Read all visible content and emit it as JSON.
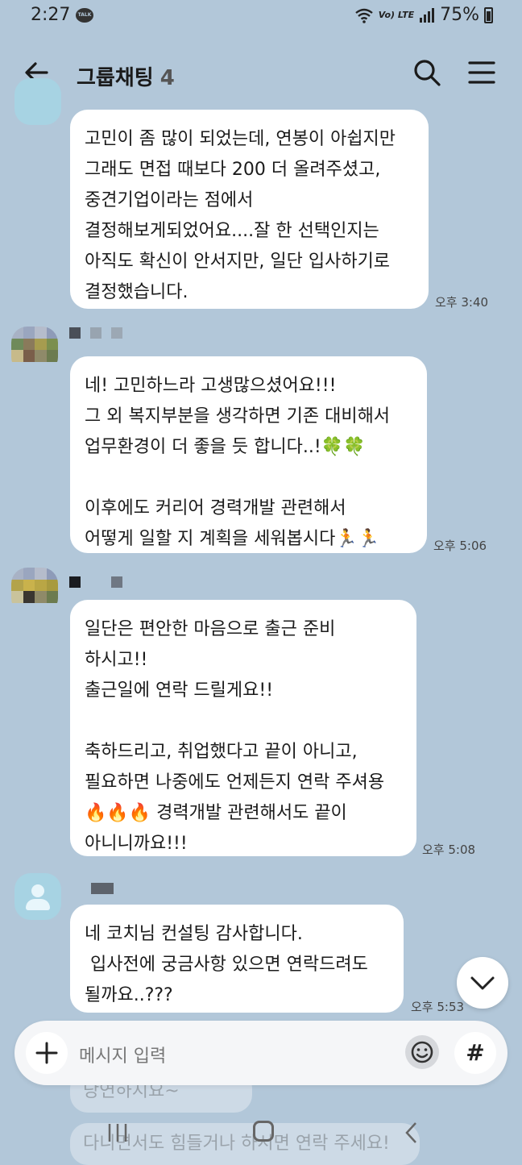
{
  "status_bar": {
    "time": "2:27",
    "talk_label": "TALK",
    "network": "Vo) LTE",
    "battery": "75%"
  },
  "header": {
    "title": "그룹채팅",
    "member_count": "4"
  },
  "messages": [
    {
      "text": "고민이 좀 많이 되었는데, 연봉이 아쉽지만\n그래도 면접 때보다 200 더 올려주셨고,\n중견기업이라는 점에서\n결정해보게되었어요....잘 한 선택인지는\n아직도 확신이 안서지만, 일단 입사하기로\n결정했습니다.",
      "time": "오후 3:40"
    },
    {
      "text": "네! 고민하느라 고생많으셨어요!!!\n그 외 복지부분을 생각하면 기존 대비해서\n업무환경이 더 좋을 듯 합니다..!🍀🍀\n\n이후에도 커리어 경력개발 관련해서\n어떻게 일할 지 계획을 세워봅시다🏃🏃",
      "time": "오후 5:06"
    },
    {
      "text": "일단은 편안한 마음으로 출근 준비\n하시고!!\n출근일에 연락 드릴게요!!\n\n축하드리고, 취업했다고 끝이 아니고,\n필요하면 나중에도 언제든지 연락 주셔용\n🔥🔥🔥 경력개발 관련해서도 끝이\n아니니까요!!!",
      "time": "오후 5:08"
    },
    {
      "text": "네 코치님 컨설팅 감사합니다.\n 입사전에 궁금사항 있으면 연락드려도\n될까요..???",
      "time": "오후 5:53"
    }
  ],
  "ghost_messages": {
    "first": "당연하지요~",
    "second": "다니면서도 힘들거나 하시면 연락 주세요!"
  },
  "input": {
    "placeholder": "메시지 입력",
    "hash_label": "#"
  },
  "colors": {
    "chat_background": "#b2c7d9",
    "bubble": "#ffffff",
    "avatar_default": "#a7d3e3"
  }
}
